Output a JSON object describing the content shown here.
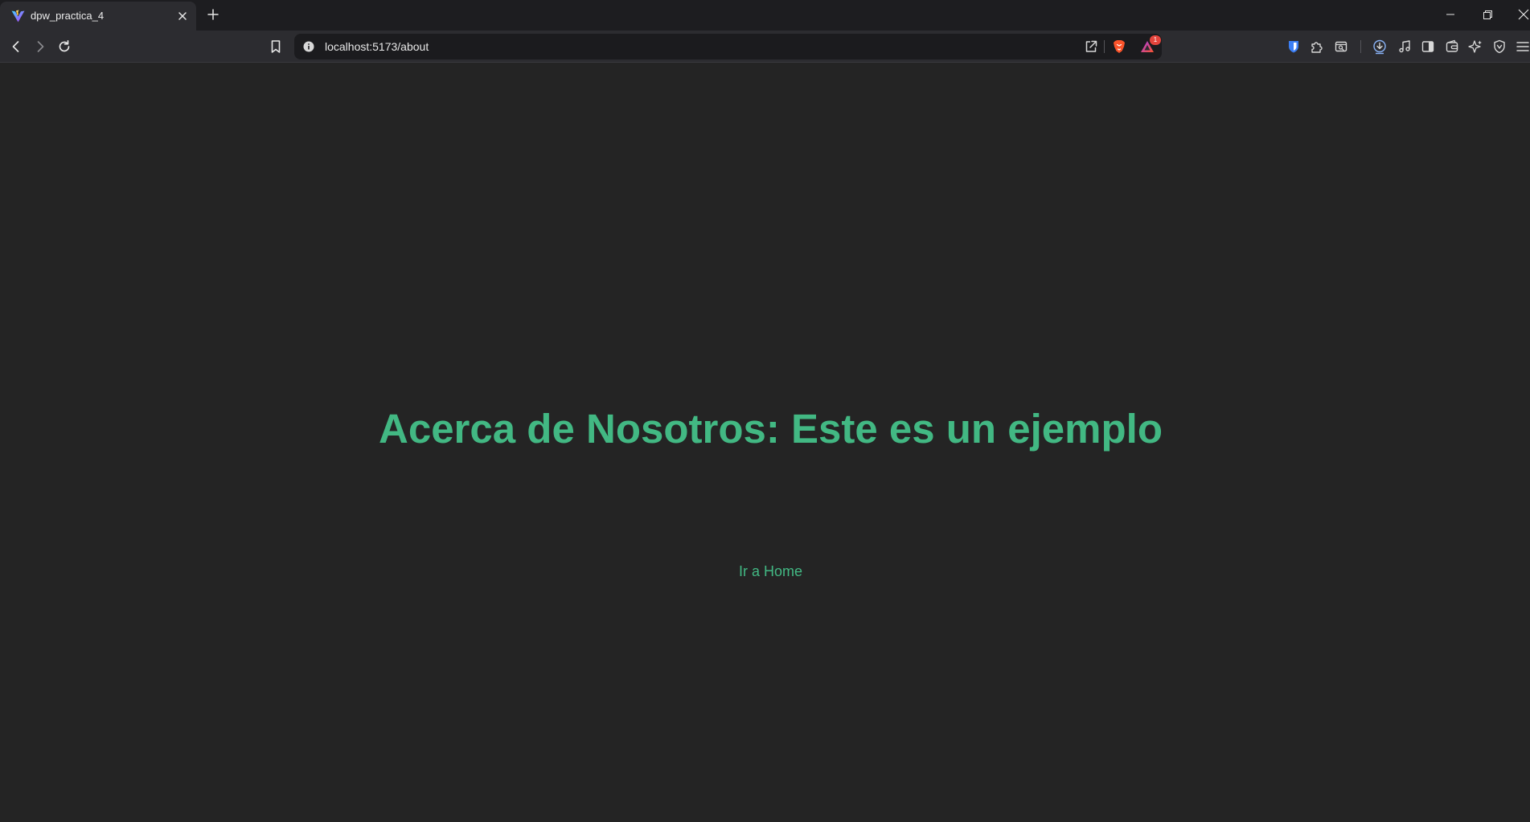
{
  "browser": {
    "tab": {
      "title": "dpw_practica_4",
      "favicon": "vite-logo-icon"
    },
    "address_bar": {
      "url": "localhost:5173/about",
      "notification_badge": "1"
    },
    "icons": {
      "back": "chevron-left-icon",
      "forward": "chevron-right-icon",
      "reload": "reload-icon",
      "bookmark": "bookmark-icon",
      "info": "info-icon",
      "share": "share-icon",
      "brave_shields": "brave-lion-icon",
      "rewards": "rewards-triangle-icon"
    }
  },
  "page": {
    "title": "Acerca de Nosotros: Este es un ejemplo",
    "home_link": "Ir a Home"
  },
  "colors": {
    "accent": "#42b883",
    "background": "#242424",
    "chrome": "#2c2c30",
    "tabstrip": "#1d1d20",
    "badge": "#e4443c"
  }
}
